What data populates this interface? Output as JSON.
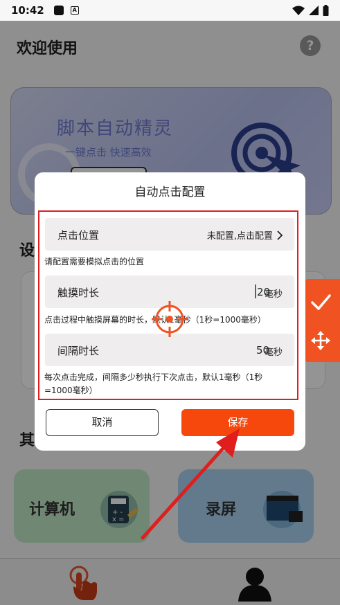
{
  "status_bar": {
    "time": "10:42",
    "notif_letter": "A"
  },
  "page": {
    "title": "欢迎使用",
    "help_glyph": "?"
  },
  "banner": {
    "title": "脚本自动精灵",
    "subtitle": "一键点击  快速高效"
  },
  "sections": {
    "settings_head": "设",
    "other_head": "其"
  },
  "tiles": {
    "calculator": "计算机",
    "recorder": "录屏"
  },
  "dialog": {
    "title": "自动点击配置",
    "position": {
      "label": "点击位置",
      "value": "未配置,点击配置",
      "hint": "请配置需要模拟点击的位置"
    },
    "duration": {
      "label": "触摸时长",
      "value": "20",
      "unit": "毫秒",
      "hint": "点击过程中触摸屏幕的时长，默认1毫秒（1秒=1000毫秒）"
    },
    "interval": {
      "label": "间隔时长",
      "value": "50",
      "unit": "毫秒",
      "hint": "每次点击完成，间隔多少秒执行下次点击，默认1毫秒（1秒=1000毫秒）"
    },
    "cancel_label": "取消",
    "save_label": "保存"
  },
  "colors": {
    "accent": "#f6470d",
    "float_panel": "#f05222",
    "highlight": "#e01e1e"
  },
  "icons": [
    "help-icon",
    "check-icon",
    "move-icon",
    "crosshair-icon",
    "chevron-right-icon",
    "tap-hand-icon",
    "user-icon"
  ]
}
